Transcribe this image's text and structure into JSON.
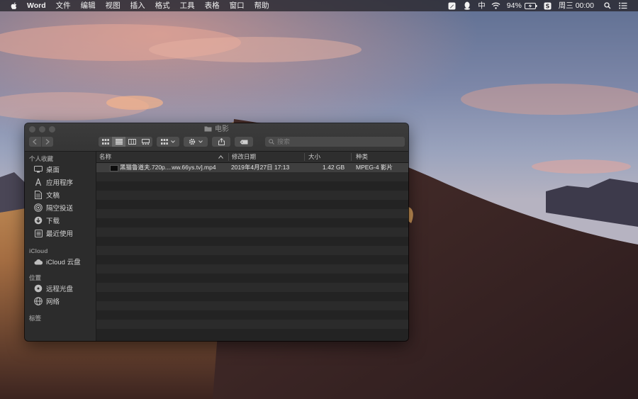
{
  "menubar": {
    "app_name": "Word",
    "menus": [
      "文件",
      "编辑",
      "视图",
      "插入",
      "格式",
      "工具",
      "表格",
      "窗口",
      "帮助"
    ],
    "input_method": "中",
    "battery_percent": "94%",
    "clock": "周三 00:00"
  },
  "window": {
    "title": "电影",
    "search_placeholder": "搜索"
  },
  "sidebar": {
    "sections": [
      {
        "heading": "个人收藏",
        "items": [
          {
            "label": "桌面",
            "icon": "desktop-icon"
          },
          {
            "label": "应用程序",
            "icon": "applications-icon"
          },
          {
            "label": "文稿",
            "icon": "documents-icon"
          },
          {
            "label": "隔空投送",
            "icon": "airdrop-icon"
          },
          {
            "label": "下载",
            "icon": "downloads-icon"
          },
          {
            "label": "最近使用",
            "icon": "recents-icon"
          }
        ]
      },
      {
        "heading": "iCloud",
        "items": [
          {
            "label": "iCloud 云盘",
            "icon": "icloud-icon"
          }
        ]
      },
      {
        "heading": "位置",
        "items": [
          {
            "label": "远程光盘",
            "icon": "remote-disc-icon"
          },
          {
            "label": "网络",
            "icon": "network-icon"
          }
        ]
      },
      {
        "heading": "标签",
        "items": []
      }
    ]
  },
  "list": {
    "columns": [
      "名称",
      "修改日期",
      "大小",
      "种类"
    ],
    "rows": [
      {
        "name": "黑猫鲁道夫.720p....ww.66ys.tv].mp4",
        "modified": "2019年4月27日 17:13",
        "size": "1.42 GB",
        "kind": "MPEG-4 影片"
      }
    ]
  },
  "colors": {
    "menubar_bg": "#2a2830",
    "window_bg": "#242424",
    "sidebar_bg": "#2c2c2c",
    "selected_row": "#3f3f3f"
  }
}
